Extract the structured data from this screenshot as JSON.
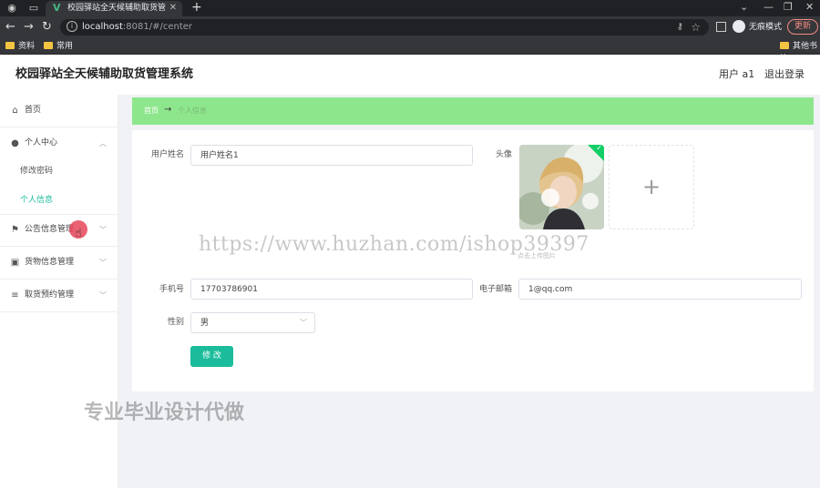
{
  "browser": {
    "tab_title": "校园驿站全天候辅助取货管理系统",
    "url_host": "localhost",
    "url_path": ":8081/#/center",
    "incognito_label": "无痕模式",
    "update_label": "更新",
    "bookmarks": [
      "资料",
      "常用"
    ],
    "other_bookmarks": "其他书签"
  },
  "header": {
    "title": "校园驿站全天候辅助取货管理系统",
    "user": "用户 a1",
    "logout": "退出登录"
  },
  "sidebar": {
    "home": "首页",
    "personal_center": "个人中心",
    "change_password": "修改密码",
    "personal_info": "个人信息",
    "announcement": "公告信息管理",
    "goods": "货物信息管理",
    "pickup": "取货预约管理"
  },
  "breadcrumb": {
    "home": "首页",
    "separator": "→",
    "current": "个人信息"
  },
  "form": {
    "username_label": "用户姓名",
    "username_value": "用户姓名1",
    "avatar_label": "头像",
    "upload_hint": "点击上传图片",
    "phone_label": "手机号",
    "phone_value": "17703786901",
    "email_label": "电子邮箱",
    "email_value": "1@qq.com",
    "gender_label": "性别",
    "gender_value": "男",
    "submit": "修 改"
  },
  "overlay": {
    "watermark_url": "https://www.huzhan.com/ishop39397",
    "watermark_cn": "专业毕业设计代做"
  },
  "colors": {
    "accent": "#1bbc9b",
    "breadcrumb_bg": "#8ee68c",
    "check": "#13ce66"
  }
}
